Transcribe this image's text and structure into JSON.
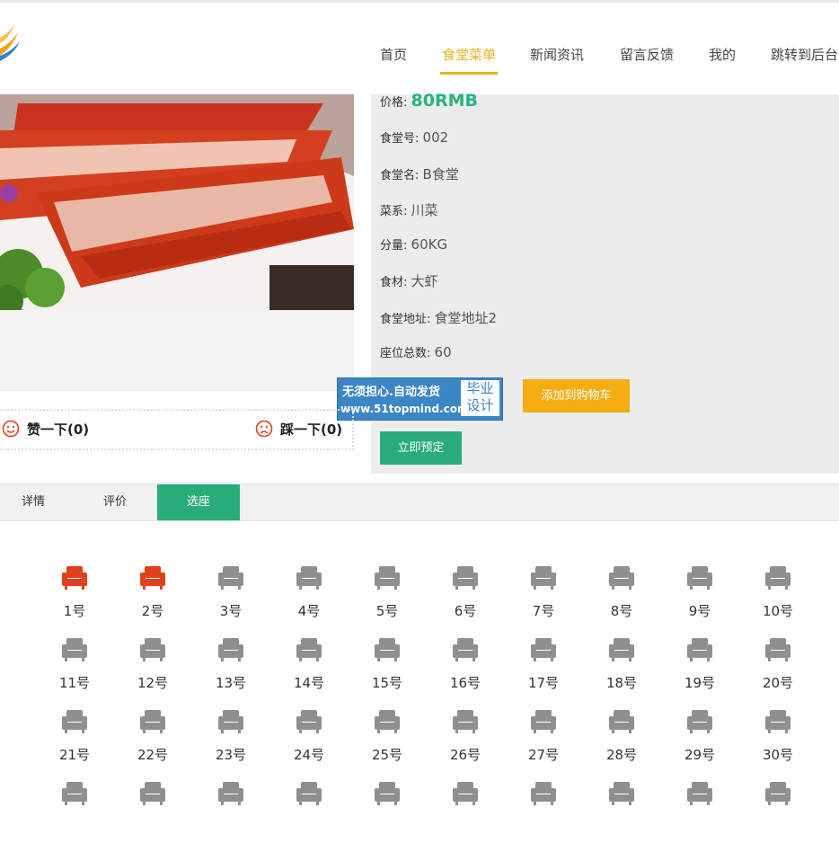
{
  "nav": {
    "items": [
      {
        "label": "首页",
        "active": false
      },
      {
        "label": "食堂菜单",
        "active": true
      },
      {
        "label": "新闻资讯",
        "active": false
      },
      {
        "label": "留言反馈",
        "active": false
      },
      {
        "label": "我的",
        "active": false
      },
      {
        "label": "跳转到后台",
        "active": false
      }
    ]
  },
  "detail": {
    "price_label": "价格:",
    "price_value": "80RMB",
    "rows": [
      {
        "label": "食堂号:",
        "value": "002"
      },
      {
        "label": "食堂名:",
        "value": "B食堂"
      },
      {
        "label": "菜系:",
        "value": "川菜"
      },
      {
        "label": "分量:",
        "value": "60KG"
      },
      {
        "label": "食材:",
        "value": "大虾"
      },
      {
        "label": "食堂地址:",
        "value": "食堂地址2"
      },
      {
        "label": "座位总数:",
        "value": "60"
      }
    ],
    "add_cart_label": "添加到购物车",
    "book_label": "立即预定"
  },
  "ad": {
    "line1": "无须担心.自动发货",
    "line2": "www.51topmind.com",
    "badge_line1": "毕业",
    "badge_line2": "设计"
  },
  "votes": {
    "like_label": "赞一下(0)",
    "dislike_label": "踩一下(0)"
  },
  "tabs": [
    {
      "label": "详情",
      "active": false
    },
    {
      "label": "评价",
      "active": false
    },
    {
      "label": "选座",
      "active": true
    }
  ],
  "colors": {
    "accent_nav": "#e8b21a",
    "green": "#28ad7a",
    "orange": "#f6ad10",
    "seat_taken": "#e0401c",
    "seat_free": "#8f8f8f"
  },
  "seats": [
    {
      "label": "1号",
      "taken": true
    },
    {
      "label": "2号",
      "taken": true
    },
    {
      "label": "3号",
      "taken": false
    },
    {
      "label": "4号",
      "taken": false
    },
    {
      "label": "5号",
      "taken": false
    },
    {
      "label": "6号",
      "taken": false
    },
    {
      "label": "7号",
      "taken": false
    },
    {
      "label": "8号",
      "taken": false
    },
    {
      "label": "9号",
      "taken": false
    },
    {
      "label": "10号",
      "taken": false
    },
    {
      "label": "11号",
      "taken": false
    },
    {
      "label": "12号",
      "taken": false
    },
    {
      "label": "13号",
      "taken": false
    },
    {
      "label": "14号",
      "taken": false
    },
    {
      "label": "15号",
      "taken": false
    },
    {
      "label": "16号",
      "taken": false
    },
    {
      "label": "17号",
      "taken": false
    },
    {
      "label": "18号",
      "taken": false
    },
    {
      "label": "19号",
      "taken": false
    },
    {
      "label": "20号",
      "taken": false
    },
    {
      "label": "21号",
      "taken": false
    },
    {
      "label": "22号",
      "taken": false
    },
    {
      "label": "23号",
      "taken": false
    },
    {
      "label": "24号",
      "taken": false
    },
    {
      "label": "25号",
      "taken": false
    },
    {
      "label": "26号",
      "taken": false
    },
    {
      "label": "27号",
      "taken": false
    },
    {
      "label": "28号",
      "taken": false
    },
    {
      "label": "29号",
      "taken": false
    },
    {
      "label": "30号",
      "taken": false
    }
  ]
}
